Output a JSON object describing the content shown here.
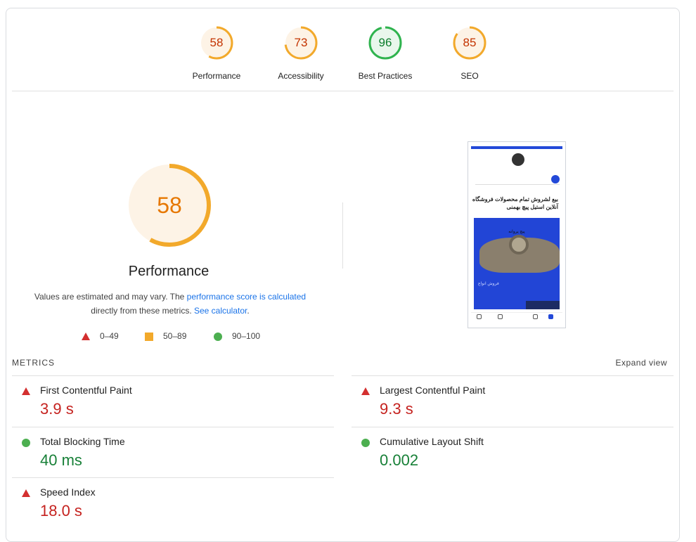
{
  "summary_gauges": [
    {
      "label": "Performance",
      "score": "58",
      "status": "average"
    },
    {
      "label": "Accessibility",
      "score": "73",
      "status": "average"
    },
    {
      "label": "Best Practices",
      "score": "96",
      "status": "pass"
    },
    {
      "label": "SEO",
      "score": "85",
      "status": "average"
    }
  ],
  "performance": {
    "score": "58",
    "title": "Performance",
    "desc_prefix": "Values are estimated and may vary. The ",
    "desc_link1": "performance score is calculated",
    "desc_middle": "directly from these metrics. ",
    "desc_link2": "See calculator",
    "desc_suffix": "."
  },
  "legend": {
    "fail": "0–49",
    "average": "50–89",
    "pass": "90–100"
  },
  "colors": {
    "fail": "#d32f2f",
    "average": "#e67700",
    "average_ring": "#f2a92b",
    "pass": "#0c9d34",
    "link": "#1a73e8"
  },
  "screenshot": {
    "hero_text_line1": "بیع لشروش تمام محصولات فروشگاه",
    "hero_text_line2": "آنلاین استیل پیچ بهمنی",
    "hero_caption": "پیچ پروانه",
    "hero_sub": "فروش انواع"
  },
  "metrics": {
    "heading": "METRICS",
    "expand_label": "Expand view",
    "items": [
      {
        "name": "First Contentful Paint",
        "value": "3.9 s",
        "status": "fail"
      },
      {
        "name": "Largest Contentful Paint",
        "value": "9.3 s",
        "status": "fail"
      },
      {
        "name": "Total Blocking Time",
        "value": "40 ms",
        "status": "pass"
      },
      {
        "name": "Cumulative Layout Shift",
        "value": "0.002",
        "status": "pass"
      },
      {
        "name": "Speed Index",
        "value": "18.0 s",
        "status": "fail"
      }
    ]
  }
}
